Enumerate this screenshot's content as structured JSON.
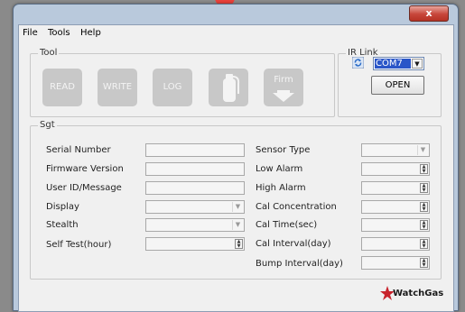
{
  "window": {
    "close_label": "x"
  },
  "menu": [
    "File",
    "Tools",
    "Help"
  ],
  "tool_group": {
    "title": "Tool",
    "buttons": [
      {
        "label": "READ"
      },
      {
        "label": "WRITE"
      },
      {
        "label": "LOG"
      },
      {
        "label": ""
      },
      {
        "label": "Firm"
      }
    ]
  },
  "ir_link": {
    "title": "IR Link",
    "port": "COM7",
    "open_label": "OPEN"
  },
  "set_group": {
    "title": "Sgt",
    "left_fields": [
      {
        "label": "Serial Number",
        "value": ""
      },
      {
        "label": "Firmware Version",
        "value": ""
      },
      {
        "label": "User ID/Message",
        "value": ""
      },
      {
        "label": "Display",
        "value": ""
      },
      {
        "label": "Stealth",
        "value": ""
      },
      {
        "label": "Self Test(hour)",
        "value": ""
      }
    ],
    "right_fields": [
      {
        "label": "Sensor Type",
        "value": ""
      },
      {
        "label": "Low Alarm",
        "value": ""
      },
      {
        "label": "High Alarm",
        "value": ""
      },
      {
        "label": "Cal Concentration",
        "value": ""
      },
      {
        "label": "Cal Time(sec)",
        "value": ""
      },
      {
        "label": "Cal Interval(day)",
        "value": ""
      },
      {
        "label": "Bump Interval(day)",
        "value": ""
      }
    ]
  },
  "logo": {
    "text": "WatchGas"
  },
  "colors": {
    "accent": "#2a56c8",
    "disabled_button": "#c8c8c8",
    "close_button": "#c7463a"
  }
}
